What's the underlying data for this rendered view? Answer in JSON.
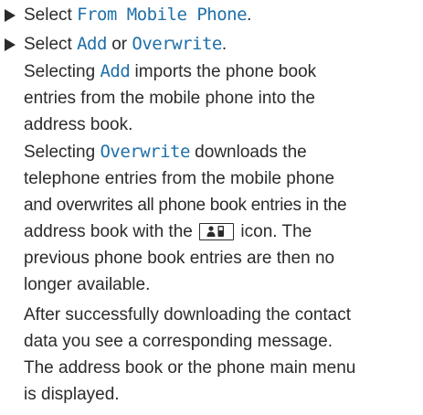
{
  "steps": [
    {
      "prefix": "Select ",
      "highlight": "From Mobile Phone",
      "suffix": "."
    },
    {
      "prefix": "Select ",
      "highlight_a": "Add",
      "middle": " or ",
      "highlight_b": "Overwrite",
      "suffix": "."
    }
  ],
  "add_paragraph": {
    "prefix": "Selecting ",
    "highlight": "Add",
    "line1_rest": " imports the phone book",
    "line2": "entries from the mobile phone into the",
    "line3": "address book."
  },
  "overwrite_paragraph": {
    "prefix": "Selecting ",
    "highlight": "Overwrite",
    "line1_rest": " downloads the",
    "line2": "telephone entries from the mobile phone",
    "line3": "and overwrites all phone book entries in the",
    "line4_before_icon": "address book with the ",
    "icon": "contact-phone-icon",
    "line4_after_icon": " icon. The",
    "line5": "previous phone book entries are then no",
    "line6": "longer available."
  },
  "result_paragraph": {
    "line1": "After successfully downloading the contact",
    "line2": "data you see a corresponding message.",
    "line3": "The address book or the phone main menu",
    "line4": "is displayed."
  },
  "colors": {
    "text": "#2b2b2b",
    "highlight": "#1f6fa8"
  }
}
